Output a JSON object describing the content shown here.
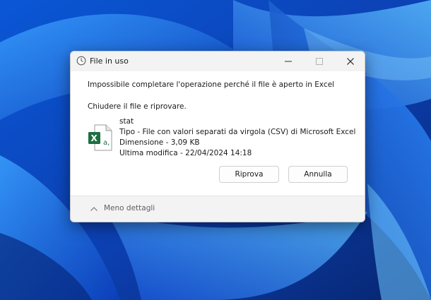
{
  "window": {
    "title": "File in uso",
    "minimize_icon": "minimize-icon",
    "maximize_icon": "maximize-icon",
    "close_icon": "close-icon"
  },
  "message": {
    "line1": "Impossibile completare l'operazione perché il file è aperto in Excel",
    "line2": "Chiudere il file e riprovare."
  },
  "file": {
    "icon": "excel-csv-file-icon",
    "name": "stat",
    "type": "Tipo - File con valori separati da virgola (CSV) di Microsoft Excel",
    "size": "Dimensione - 3,09 KB",
    "modified": "Ultima modifica - 22/04/2024 14:18"
  },
  "buttons": {
    "retry": "Riprova",
    "cancel": "Annulla"
  },
  "footer": {
    "less_details": "Meno dettagli",
    "chevron_icon": "chevron-up-icon"
  },
  "colors": {
    "wallpaper_blue": "#0b3ea8",
    "excel_green": "#1d6f42",
    "dialog_bg": "#f3f3f3"
  }
}
